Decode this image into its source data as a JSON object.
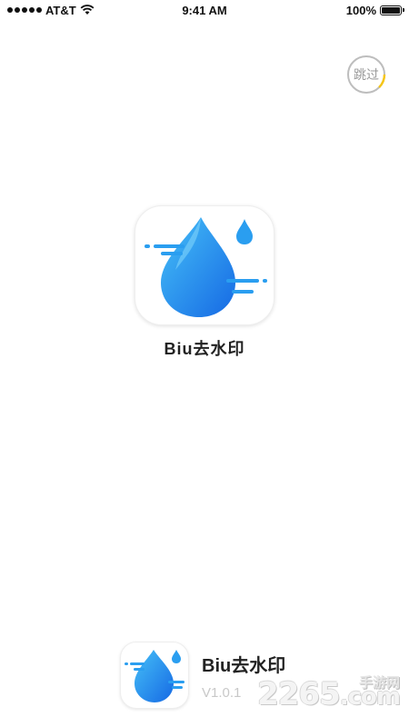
{
  "status_bar": {
    "carrier": "AT&T",
    "time": "9:41 AM",
    "battery": "100%"
  },
  "skip": {
    "label": "跳过"
  },
  "app": {
    "name": "Biu去水印",
    "version": "V1.0.1"
  },
  "watermark": {
    "number": "2265",
    "suffix": ".com",
    "site": "手游网"
  },
  "colors": {
    "drop_light": "#3fb3f5",
    "drop_dark": "#1a73e8",
    "skip_progress": "#f5c518"
  }
}
